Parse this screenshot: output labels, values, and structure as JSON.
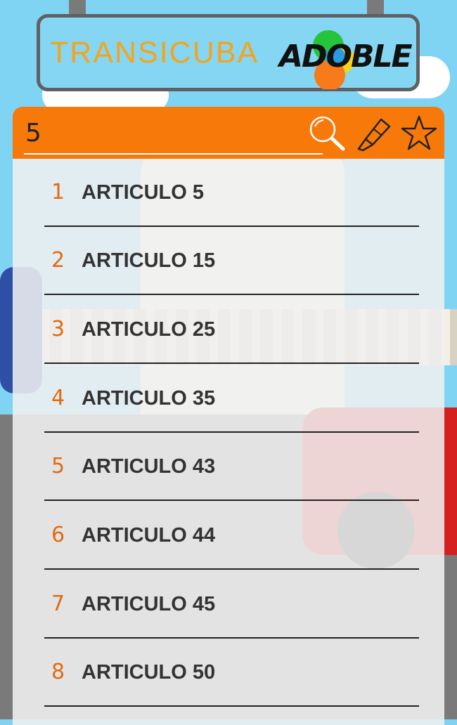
{
  "header": {
    "brand_title": "TRANSICUBA",
    "logo_text": "ADOBLE",
    "brand_color": "#f7a31a"
  },
  "search": {
    "value": "5",
    "placeholder": "",
    "search_icon": "search-icon",
    "highlighter_icon": "highlighter-icon",
    "favorites_icon": "star-icon",
    "bar_color": "#f7790a"
  },
  "results": [
    {
      "index": "1",
      "label": "ARTICULO 5"
    },
    {
      "index": "2",
      "label": "ARTICULO 15"
    },
    {
      "index": "3",
      "label": "ARTICULO 25"
    },
    {
      "index": "4",
      "label": "ARTICULO 35"
    },
    {
      "index": "5",
      "label": "ARTICULO 43"
    },
    {
      "index": "6",
      "label": "ARTICULO 44"
    },
    {
      "index": "7",
      "label": "ARTICULO 45"
    },
    {
      "index": "8",
      "label": "ARTICULO 50"
    }
  ]
}
